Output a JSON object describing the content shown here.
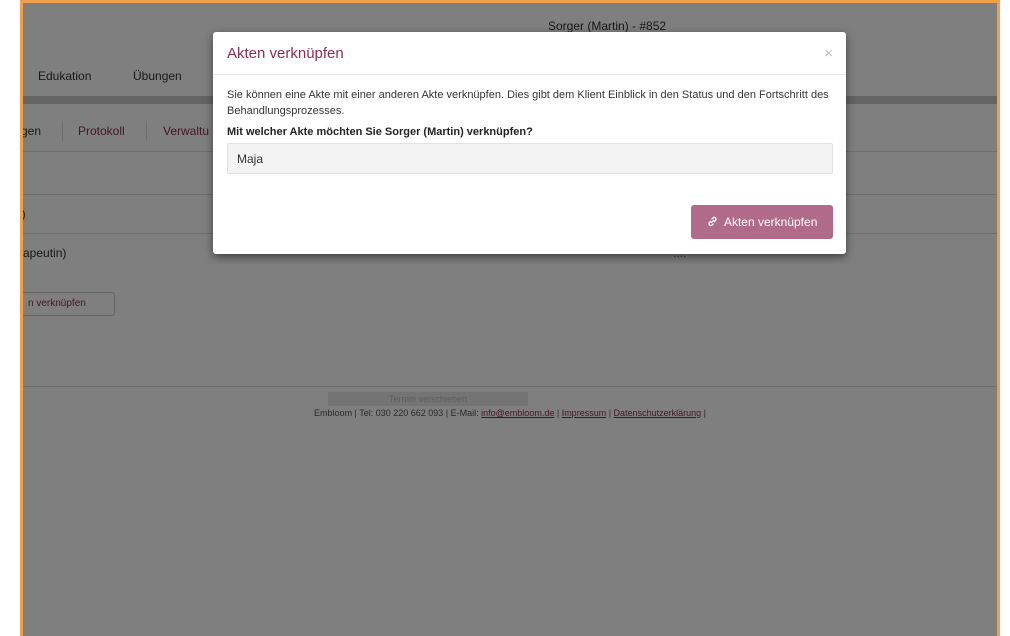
{
  "window": {
    "title": "Sorger (Martin) - #852"
  },
  "topnav": {
    "items": [
      "Edukation",
      "Übungen"
    ]
  },
  "subtabs": {
    "items": [
      "gen",
      "Protokoll",
      "Verwaltu"
    ]
  },
  "content": {
    "row1": "i)",
    "row2": "rapeutin)",
    "link_button": "n verknüpfen",
    "right_partial": "...."
  },
  "footer": {
    "ghost": "Termin verschieben",
    "prefix": "Embloom | Tel: 030 220 662 093 | E-Mail: ",
    "email": "info@embloom.de",
    "sep1": " | ",
    "impressum": "Impressum",
    "sep2": " | ",
    "datenschutz": "Datenschutzerklärung",
    "suffix": " |"
  },
  "modal": {
    "title": "Akten verknüpfen",
    "close": "×",
    "description": "Sie können eine Akte mit einer anderen Akte verknüpfen. Dies gibt dem Klient Einblick in den Status und den Fortschritt des Behandlungsprozesses.",
    "question": "Mit welcher Akte möchten Sie Sorger (Martin) verknüpfen?",
    "input_value": "Maja",
    "button_icon": "link-icon",
    "button_label": "Akten verknüpfen"
  },
  "colors": {
    "accent": "#8b2e52",
    "button": "#b06a8a",
    "frame": "#f0a04a"
  }
}
